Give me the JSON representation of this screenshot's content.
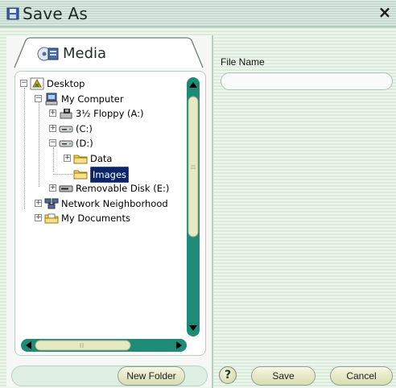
{
  "window": {
    "title": "Save As",
    "close_label": "×"
  },
  "media_tab": {
    "label": "Media"
  },
  "tree": [
    {
      "label": "Desktop",
      "level": 0,
      "expander": "−",
      "icon": "desktop-icon"
    },
    {
      "label": "My Computer",
      "level": 1,
      "expander": "−",
      "icon": "computer-icon"
    },
    {
      "label": "3½ Floppy (A:)",
      "level": 2,
      "expander": "+",
      "icon": "floppy-icon"
    },
    {
      "label": "(C:)",
      "level": 2,
      "expander": "+",
      "icon": "drive-icon"
    },
    {
      "label": "(D:)",
      "level": 2,
      "expander": "−",
      "icon": "drive-icon"
    },
    {
      "label": "Data",
      "level": 3,
      "expander": "+",
      "icon": "folder-icon"
    },
    {
      "label": "Images",
      "level": 3,
      "expander": "",
      "icon": "folder-icon",
      "selected": true
    },
    {
      "label": "Removable Disk (E:)",
      "level": 2,
      "expander": "+",
      "icon": "removable-disk-icon"
    },
    {
      "label": "Network Neighborhood",
      "level": 1,
      "expander": "+",
      "icon": "network-icon"
    },
    {
      "label": "My Documents",
      "level": 1,
      "expander": "+",
      "icon": "documents-icon"
    }
  ],
  "file_name": {
    "label": "File Name",
    "value": "",
    "placeholder": ""
  },
  "buttons": {
    "new_folder": "New Folder",
    "help": "?",
    "save": "Save",
    "cancel": "Cancel"
  },
  "colors": {
    "scroll_track": "#1e8a78",
    "scroll_thumb": "#e5e9c4",
    "selection": "#0a246a"
  }
}
